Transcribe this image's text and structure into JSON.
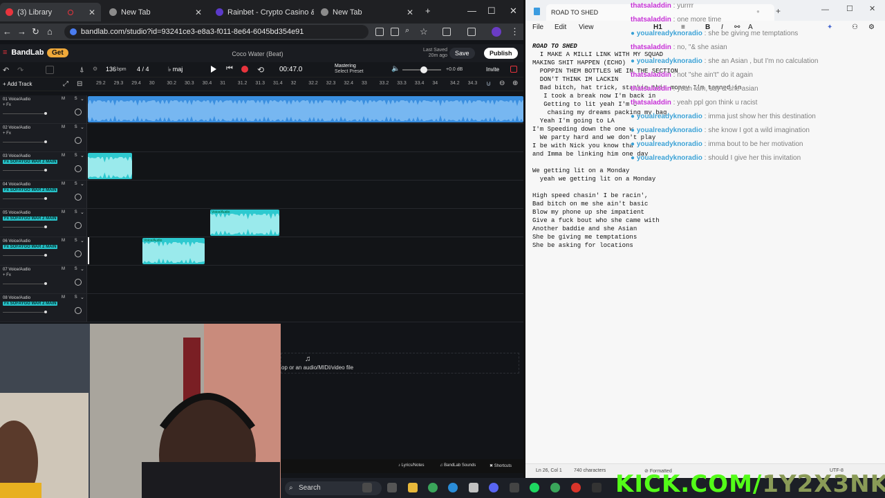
{
  "browser": {
    "tabs": [
      {
        "label": "(3) Library",
        "color": "#e8343d"
      },
      {
        "label": "New Tab",
        "color": "#8b8b8b"
      },
      {
        "label": "Rainbet - Crypto Casino & Sp",
        "color": "#5b3ac9"
      },
      {
        "label": "New Tab",
        "color": "#8b8b8b"
      }
    ],
    "url": "bandlab.com/studio?id=93241ce3-e8a3-f011-8e64-6045bd354e91"
  },
  "bandlab": {
    "logo": "BandLab",
    "get": "Get",
    "song_title": "Coco Water (Beat)",
    "last_saved": "Last Saved",
    "last_saved_ago": "20m ago",
    "save": "Save",
    "publish": "Publish",
    "bpm": "136",
    "bpm_unit": "bpm",
    "time_sig": "4 / 4",
    "key": "maj",
    "time": "00:47.0",
    "mastering": "Mastering",
    "mastering_preset": "Select Preset",
    "db": "+0.0 dB",
    "invite": "Invite",
    "add_track": "+ Add Track",
    "ruler": [
      "29.2",
      "29.3",
      "29.4",
      "30",
      "30.2",
      "30.3",
      "30.4",
      "31",
      "31.2",
      "31.3",
      "31.4",
      "32",
      "32.2",
      "32.3",
      "32.4",
      "33",
      "33.2",
      "33.3",
      "33.4",
      "34",
      "34.2",
      "34.3"
    ],
    "tracks": [
      {
        "name": "01 Voice/Audio",
        "fx": "+ Fx",
        "hl": false
      },
      {
        "name": "02 Voice/Audio",
        "fx": "+ Fx",
        "hl": false
      },
      {
        "name": "03 Voice/Audio",
        "fx": "Fx SOFAYGO WAR 2 MAIN",
        "hl": true
      },
      {
        "name": "04 Voice/Audio",
        "fx": "Fx SOFAYGO WAR 2 MAIN",
        "hl": true
      },
      {
        "name": "05 Voice/Audio",
        "fx": "Fx SOFAYGO WAR 2 MAIN",
        "hl": true
      },
      {
        "name": "06 Voice/Audio",
        "fx": "Fx SOFAYGO WAR 2 MAIN",
        "hl": true
      },
      {
        "name": "07 Voice/Audio",
        "fx": "+ Fx",
        "hl": false
      },
      {
        "name": "08 Voice/Audio",
        "fx": "Fx SOFAYGO WAR 2 MAIN",
        "hl": true
      }
    ],
    "ms": "M S",
    "clip_label": "Voice/Audio",
    "dropzone": "op or an audio/MIDI/video file",
    "footer": [
      "Lyrics/Notes",
      "BandLab Sounds",
      "Shortcuts"
    ]
  },
  "taskbar": {
    "search": "Search"
  },
  "notepad": {
    "tab_title": "ROAD TO SHED",
    "menu": [
      "File",
      "Edit",
      "View"
    ],
    "lines": [
      "ROAD TO SHED",
      "  I MAKE A MILLI LINK WITH MY SQUAD",
      "MAKING SHIT HAPPEN (ECHO)",
      "  POPPIN THEM BOTTLES WE IN THE SECTION",
      "  DON'T THINK IM LACKIN",
      "  Bad bitch, hat trick, stackin this money I'm tanned in",
      "   I took a break now I'm back in",
      "   Getting to lit yeah I'm c",
      "    chasing my dreams packing my bag",
      "  Yeah I'm going to LA",
      "I'm Speeding down the one w",
      "  We party hard and we don't play",
      "I be with Nick you know tha",
      "and Imma be linking him one day",
      "",
      "We getting lit on a Monday",
      "  yeah we getting lit on a Monday",
      "",
      "High speed chasin' I be racin',",
      "Bad bitch on me she ain't basic",
      "Blow my phone up she impatient",
      "Give a fuck bout who she came with",
      "Another baddie and she Asian",
      "She be giving me temptations",
      "She be asking for locations"
    ],
    "status_pos": "Ln 26, Col 1",
    "status_chars": "740 characters",
    "status_format": "Formatted",
    "status_enc": "UTF-8"
  },
  "chat": [
    {
      "user": "thatsaladdin",
      "msg": "yurrrr",
      "cls": "a"
    },
    {
      "user": "thatsaladdin",
      "msg": "one more time",
      "cls": "a"
    },
    {
      "user": "youalreadyknoradio",
      "msg": "she be giving me temptations",
      "cls": "b"
    },
    {
      "user": "thatsaladdin",
      "msg": "no, \"& she asian",
      "cls": "a"
    },
    {
      "user": "youalreadyknoradio",
      "msg": "she an Asian , but I'm no calculation",
      "cls": "b"
    },
    {
      "user": "thatsaladdin",
      "msg": "not \"she ain't\" do it again",
      "cls": "a"
    },
    {
      "user": "thatsaladdin",
      "msg": "yeah fam, say & she asian",
      "cls": "a"
    },
    {
      "user": "thatsaladdin",
      "msg": "yeah ppl gon think u racist",
      "cls": "a"
    },
    {
      "user": "youalreadyknoradio",
      "msg": "imma just show her this destination",
      "cls": "b"
    },
    {
      "user": "youalreadyknoradio",
      "msg": "she know I got a wild imagination",
      "cls": "b"
    },
    {
      "user": "youalreadyknoradio",
      "msg": "imma bout to be her motivation",
      "cls": "b"
    },
    {
      "user": "youalreadyknoradio",
      "msg": "should I give her this invitation",
      "cls": "b"
    }
  ],
  "kick": "KICK.COM/",
  "kick_channel": "1Y2X3NKY"
}
